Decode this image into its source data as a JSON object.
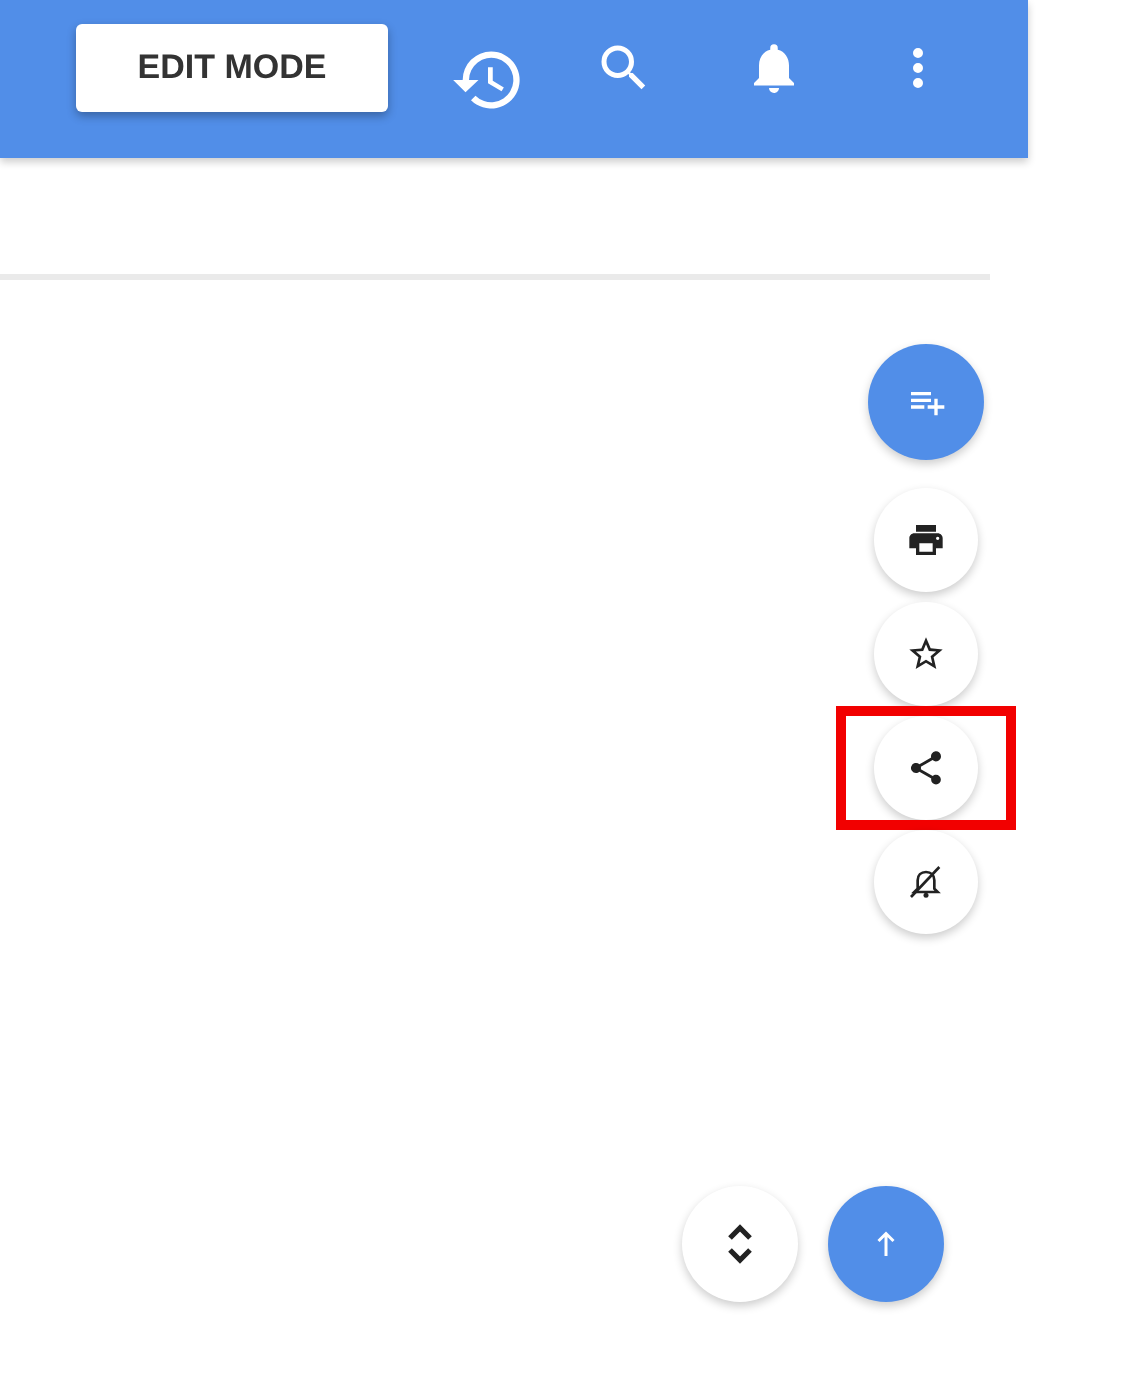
{
  "header": {
    "edit_button": "EDIT MODE"
  },
  "speed_dial": {
    "actions": [
      {
        "kind": "print",
        "highlighted": false
      },
      {
        "kind": "star",
        "highlighted": false
      },
      {
        "kind": "share",
        "highlighted": true
      },
      {
        "kind": "mute",
        "highlighted": false
      }
    ]
  },
  "bottom_buttons": [
    {
      "kind": "expand"
    },
    {
      "kind": "top"
    }
  ]
}
